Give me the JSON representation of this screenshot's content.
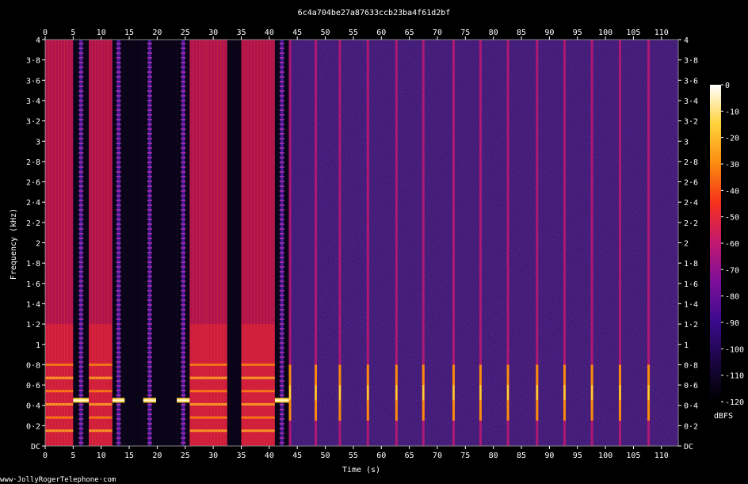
{
  "chart_data": {
    "type": "heatmap",
    "title": "6c4a704be27a87633ccb23ba4f61d2bf",
    "xlabel": "Time (s)",
    "ylabel": "Frequency (kHz)",
    "xlim": [
      0,
      113
    ],
    "ylim": [
      0,
      4
    ],
    "x_ticks": [
      0,
      5,
      10,
      15,
      20,
      25,
      30,
      35,
      40,
      45,
      50,
      55,
      60,
      65,
      70,
      75,
      80,
      85,
      90,
      95,
      100,
      105,
      110
    ],
    "x_tick_labels": [
      "0",
      "5",
      "10",
      "15",
      "20",
      "25",
      "30",
      "35",
      "40",
      "45",
      "50",
      "55",
      "60",
      "65",
      "70",
      "75",
      "80",
      "85",
      "90",
      "95",
      "100",
      "105",
      "110"
    ],
    "y_ticks": [
      0,
      0.2,
      0.4,
      0.6,
      0.8,
      1,
      1.2,
      1.4,
      1.6,
      1.8,
      2,
      2.2,
      2.4,
      2.6,
      2.8,
      3,
      3.2,
      3.4,
      3.6,
      3.8,
      4
    ],
    "y_tick_labels": [
      "DC",
      "0·2",
      "0·4",
      "0·6",
      "0·8",
      "1",
      "1·2",
      "1·4",
      "1·6",
      "1·8",
      "2",
      "2·2",
      "2·4",
      "2·6",
      "2·8",
      "3",
      "3·2",
      "3·4",
      "3·6",
      "3·8",
      "4"
    ],
    "colorbar": {
      "unit": "dBFS",
      "range": [
        -120,
        0
      ],
      "ticks": [
        0,
        -10,
        -20,
        -30,
        -40,
        -50,
        -60,
        -70,
        -80,
        -90,
        -100,
        -110,
        -120
      ],
      "tick_labels": [
        "0",
        "-10",
        "-20",
        "-30",
        "-40",
        "-50",
        "-60",
        "-70",
        "-80",
        "-90",
        "-100",
        "-110",
        "-120"
      ],
      "colors": [
        "#000000",
        "#1a0640",
        "#3b0a8c",
        "#7a0f9a",
        "#c21872",
        "#f5301d",
        "#fb8a0e",
        "#ffd23a",
        "#ffffff"
      ]
    },
    "segments": [
      {
        "x": [
          0,
          5
        ],
        "kind": "speech"
      },
      {
        "x": [
          5,
          7.8
        ],
        "kind": "tone-burst"
      },
      {
        "x": [
          7.8,
          12
        ],
        "kind": "speech"
      },
      {
        "x": [
          12,
          14.2
        ],
        "kind": "tone-burst"
      },
      {
        "x": [
          14.2,
          17.5
        ],
        "kind": "silence"
      },
      {
        "x": [
          17.5,
          19.8
        ],
        "kind": "tone-burst"
      },
      {
        "x": [
          19.8,
          23.5
        ],
        "kind": "silence"
      },
      {
        "x": [
          23.5,
          25.8
        ],
        "kind": "tone-burst"
      },
      {
        "x": [
          25.8,
          29
        ],
        "kind": "speech"
      },
      {
        "x": [
          29,
          32.5
        ],
        "kind": "speech"
      },
      {
        "x": [
          32.5,
          35
        ],
        "kind": "silence"
      },
      {
        "x": [
          35,
          41
        ],
        "kind": "speech"
      },
      {
        "x": [
          41,
          43.5
        ],
        "kind": "tone-burst"
      }
    ],
    "tone_hz_khz": 0.45,
    "pulses_s": [
      43.7,
      48.3,
      52.6,
      57.6,
      62.7,
      67.5,
      72.9,
      77.7,
      82.6,
      87.8,
      92.7,
      97.6,
      102.6,
      107.7
    ]
  },
  "watermark": "www·JollyRogerTelephone·com"
}
